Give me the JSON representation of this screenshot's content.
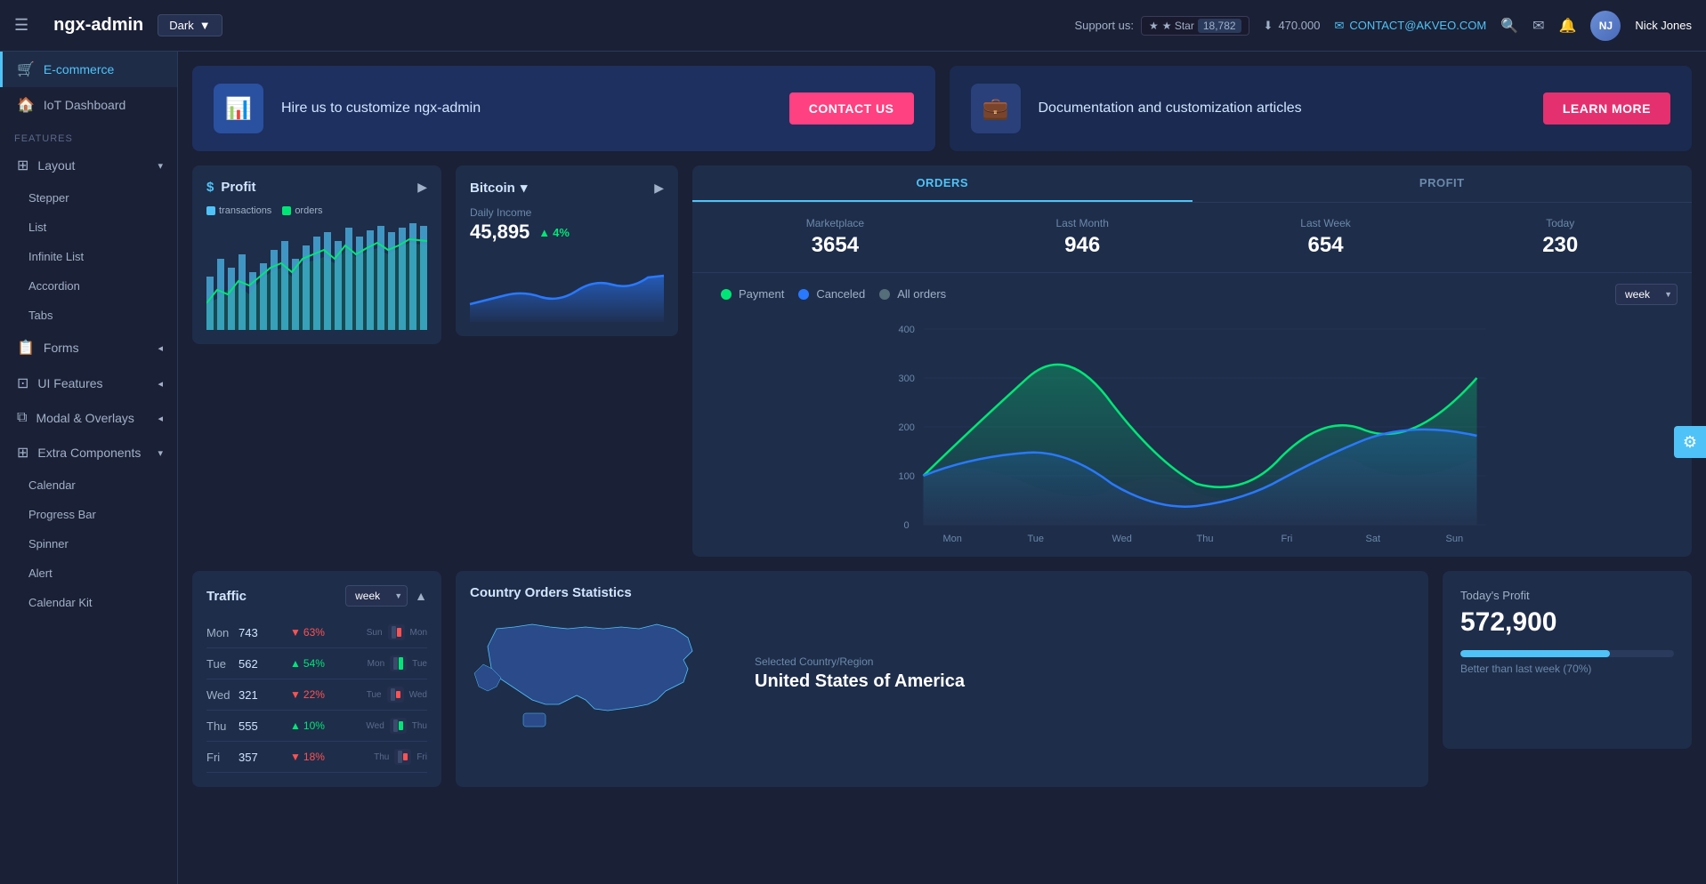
{
  "app": {
    "logo": "ngx-admin",
    "theme": "Dark",
    "hamburger": "☰"
  },
  "topnav": {
    "support_label": "Support us:",
    "star_label": "★ Star",
    "star_count": "18,782",
    "download_icon": "⬇",
    "download_value": "470.000",
    "email_icon": "✉",
    "email": "CONTACT@AKVEO.COM",
    "search_icon": "🔍",
    "mail_icon": "✉",
    "bell_icon": "🔔",
    "username": "Nick Jones"
  },
  "sidebar": {
    "ecommerce_label": "E-commerce",
    "iot_label": "IoT Dashboard",
    "features_section": "FEATURES",
    "layout_label": "Layout",
    "stepper_label": "Stepper",
    "list_label": "List",
    "infinite_list_label": "Infinite List",
    "accordion_label": "Accordion",
    "tabs_label": "Tabs",
    "forms_label": "Forms",
    "ui_features_label": "UI Features",
    "modal_overlays_label": "Modal & Overlays",
    "extra_components_label": "Extra Components",
    "calendar_label": "Calendar",
    "progress_bar_label": "Progress Bar",
    "spinner_label": "Spinner",
    "alert_label": "Alert",
    "calendar_kit_label": "Calendar Kit"
  },
  "banners": {
    "left": {
      "icon": "📊",
      "text": "Hire us to customize ngx-admin",
      "button": "CONTACT US"
    },
    "right": {
      "icon": "💼",
      "text": "Documentation and customization articles",
      "button": "LEARN MORE"
    }
  },
  "profit_card": {
    "title": "Profit",
    "dollar_sign": "$",
    "legend_transactions": "transactions",
    "legend_orders": "orders"
  },
  "bitcoin_card": {
    "currency": "Bitcoin",
    "daily_income_label": "Daily Income",
    "daily_income_value": "45,895",
    "pct_change": "4%",
    "pct_direction": "up"
  },
  "orders_card": {
    "tab_orders": "ORDERS",
    "tab_profit": "PROFIT",
    "stats": [
      {
        "label": "Marketplace",
        "value": "3654"
      },
      {
        "label": "Last Month",
        "value": "946"
      },
      {
        "label": "Last Week",
        "value": "654"
      },
      {
        "label": "Today",
        "value": "230"
      }
    ],
    "legend": [
      {
        "label": "Payment",
        "color": "#00e676"
      },
      {
        "label": "Canceled",
        "color": "#2979ff"
      },
      {
        "label": "All orders",
        "color": "#546e7a"
      }
    ],
    "week_label": "week",
    "yaxis": [
      "0",
      "100",
      "200",
      "300",
      "400"
    ],
    "xaxis": [
      "Mon",
      "Tue",
      "Wed",
      "Thu",
      "Fri",
      "Sat",
      "Sun"
    ]
  },
  "traffic_card": {
    "title": "Traffic",
    "week_label": "week",
    "rows": [
      {
        "day": "Mon",
        "value": "743",
        "pct": "63%",
        "direction": "down"
      },
      {
        "day": "Tue",
        "value": "562",
        "pct": "54%",
        "direction": "up"
      },
      {
        "day": "Wed",
        "value": "321",
        "pct": "22%",
        "direction": "down"
      },
      {
        "day": "Thu",
        "value": "555",
        "pct": "10%",
        "direction": "up"
      },
      {
        "day": "Fri",
        "value": "357",
        "pct": "18%",
        "direction": "down"
      }
    ]
  },
  "country_card": {
    "title": "Country Orders Statistics",
    "selected_label": "Selected Country/Region",
    "country": "United States of America"
  },
  "profit_today": {
    "label": "Today's Profit",
    "value": "572,900",
    "bar_pct": 70,
    "better_text": "Better than last week (70%)"
  },
  "settings_icon": "⚙"
}
